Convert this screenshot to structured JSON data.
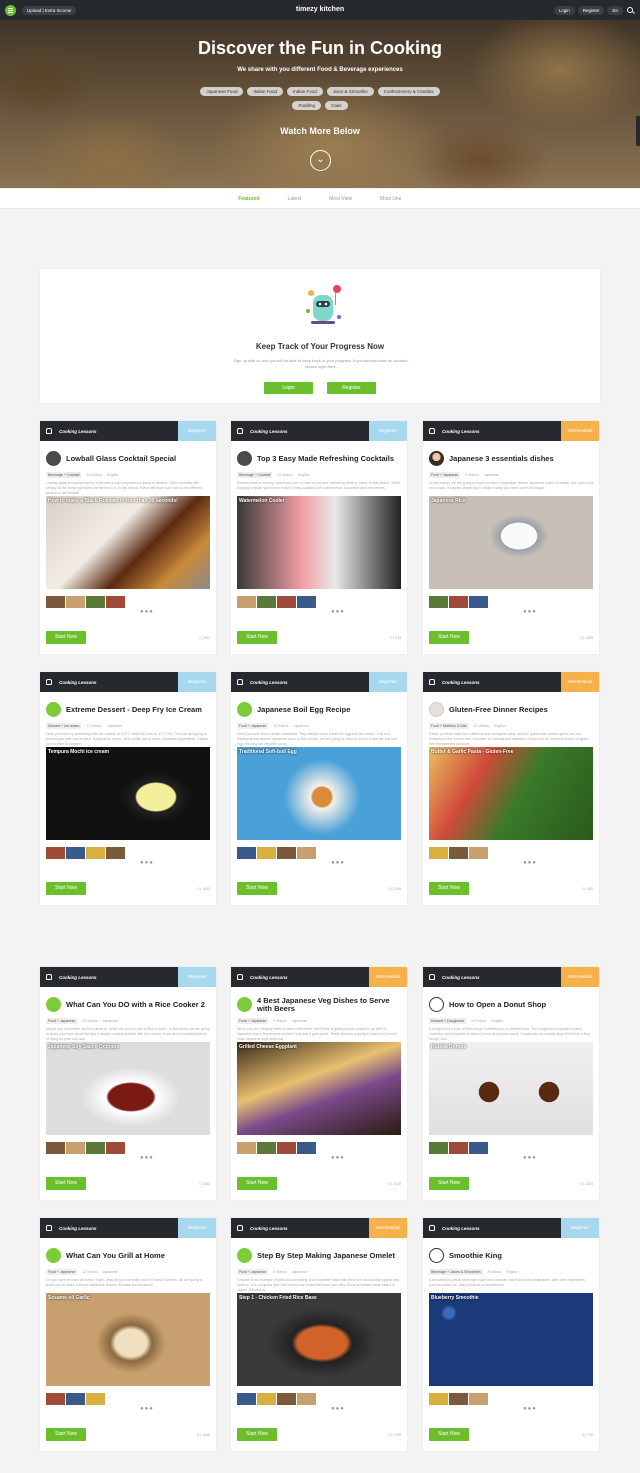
{
  "topbar": {
    "upload_label": "Upload | Extra Income",
    "brand": "timezy kitchen",
    "login_label": "Login",
    "register_label": "Register",
    "lang_label": "En"
  },
  "hero": {
    "title": "Discover the Fun in Cooking",
    "subtitle": "We share with you different Food & Beverage experiences",
    "tags": [
      "Japanese Food",
      "Italian Food",
      "Indian Food",
      "Juice & Smoothie",
      "Confectionery & Candies",
      "Pudding",
      "Cake"
    ],
    "watch_more": "Watch More Below"
  },
  "tabs": [
    "Featured",
    "Latest",
    "Most View",
    "Most Like"
  ],
  "progress": {
    "title": "Keep Track of Your Progress Now",
    "description": "Sign up with us and you will be able to keep track of your progress. If you already have an account, please login here.",
    "login_label": "Login",
    "register_label": "Register"
  },
  "card_common": {
    "header_label": "Cooking Lessons",
    "start_label": "Start Now"
  },
  "cards": [
    {
      "level": "Beginner",
      "title": "Lowball Glass Cocktail Special",
      "category": "Beverage + Cocktail",
      "videos": "34 Videos",
      "lang": "English",
      "desc": "Lowball glass is usually used to drink with a high proportion of liquor to alcohol. Often cocktails with whisky as the base ingredient are served in it. In this lesson, Steve will teach you how to mix different alcohol in the lowball!",
      "image_caption": "How to make a Black Russian in less than 30 seconds!",
      "stats": "0 | 801"
    },
    {
      "level": "Beginner",
      "title": "Top 3 Easy Made Refreshing Cocktails",
      "category": "Beverage + Cocktail",
      "videos": "13 Videos",
      "lang": "English",
      "desc": "Summer time is coming, would you love to have a cool and refreshing drink on hand. In this lesson, Steve is going to teach you how to make 3 easy cocktails with watermelon, cucumber and mint leaves.",
      "image_caption": "Watermelon Cooler",
      "stats": "0 | 913"
    },
    {
      "level": "Intermediate",
      "title": "Japanese 3 essentials dishes",
      "category": "Food + Japanese",
      "videos": "9 Videos",
      "lang": "Japanese",
      "desc": "In this lesson, we are going to teach you the 3 essentials dishes Japanese make for meals, rice, gobo and miso soup. It sounds simple but to make it tasty, you need some technique.",
      "image_caption": "Japanese Rice",
      "stats": "0 | 1489"
    },
    {
      "level": "Beginner",
      "title": "Extreme Dessert - Deep Fry Ice Cream",
      "category": "Dessert + Ice cream",
      "videos": "12 Videos",
      "lang": "Japanese",
      "desc": "Have you ever try something with the outside of 200°C while the core is -4°C? No! Then we are going to present you with one dessert, tempura ice cream. With a little use of some Japanese ingredients, it takes you no time to prepare.",
      "image_caption": "Tempura Mochi ice cream",
      "stats": "0 | 1933"
    },
    {
      "level": "Beginner",
      "title": "Japanese Boil Egg Recipe",
      "category": "Food + Japanese",
      "videos": "10 Videos",
      "lang": "Japanese",
      "desc": "Have you ever visit a ramen restaurant. They always serve a soft boil egg with the ramen. This is a traditional way almost Japanese does. In this course, we are going to show to how to make the soft boil egg. It's easy but required some",
      "image_caption": "Traditional Soft-boil Egg",
      "stats": "0 | 2108"
    },
    {
      "level": "Intermediate",
      "title": "Gluten-Free Dinner Recipes",
      "category": "Food + Nutrition & Diet",
      "videos": "15 Videos",
      "lang": "English",
      "desc": "Gluten proteins have low nutritional and biological value, and the grains that contain gluten are not essential in the human diet. However, an unbalanced selection of food and an incorrect choice of gluten-free replacement products",
      "image_caption": "Butter & Garlic Pasta - Gluten-Free",
      "stats": "0 | 982"
    },
    {
      "level": "Beginner",
      "title": "What Can You DO with a Rice Cooker 2",
      "category": "Food + Japanese",
      "videos": "10 Videos",
      "lang": "Japanese",
      "desc": "Maybe you have seen our first series of \"What can you do with a Rice Cooker\". In this series we are going to show you more about the fast & simple cooking method with rice cooker. If you are in boarding school or living on your own and",
      "image_caption": "Japanese Soy Sauce Octopus",
      "stats": "0 | 882"
    },
    {
      "level": "Intermediate",
      "title": "4 Best Japanese Veg Dishes to Serve with Beers",
      "category": "Food + Japanese",
      "videos": "8 Videos",
      "lang": "Japanese",
      "desc": "When you are drinking beers at home with friend, ever think of getting some snacks to go with it? Japanese has a few recipes for beer food and it goes great. These lessons is going to teach you how to cook Japanese style delicious",
      "image_caption": "Grilled Cheese Eggplant",
      "stats": "0 | 1019"
    },
    {
      "level": "Intermediate",
      "title": "How to Open a Donut Shop",
      "category": "Dessert + Doughnuts",
      "videos": "10 Videos",
      "lang": "English",
      "desc": "A doughnut is a type of fried dough confectionery or dessert food. The doughnut is popular in many countries and prepared in various forms as a sweet snack. Doughnuts are usually deep fried from a flour dough, and",
      "image_caption": "Nutella Donuts",
      "stats": "0 | 1233"
    },
    {
      "level": "Beginner",
      "title": "What Can You Grill at Home",
      "category": "Food + Japanese",
      "videos": "12 Videos",
      "lang": "Japanese",
      "desc": "Do you have an oven at home? If yes, what do you normally cook? In these 3 videos, we are going to teach you to make 3 simple Japanese dishes. It's easy and delicious!",
      "image_caption": "Sesame oil Garlic",
      "stats": "0 | 1868"
    },
    {
      "level": "Intermediate",
      "title": "Step By Step Making Japanese Omelet",
      "category": "Food + Japanese",
      "videos": "8 Videos",
      "lang": "Japanese",
      "desc": "Omurice is an example of yōshoku consisting of an omelette made with fried rice and usually topped with ketchup. It is a popular dish both commonly cooked at home and often found at western style diners in Japan. Omurice is",
      "image_caption": "Step 1 - Chicken Fried Rice Base",
      "stats": "0 | 1799"
    },
    {
      "level": "Beginner",
      "title": "Smoothie King",
      "category": "Beverage + Juices & Smoothies",
      "videos": "9 Videos",
      "lang": "English",
      "desc": "A smoothie is a thick beverage made from blended raw fruit and/or vegetables, with other ingredients such as water, ice, dairy products or sweeteners",
      "image_caption": "Blueberry Smoothie",
      "stats": "0 | 790"
    }
  ]
}
